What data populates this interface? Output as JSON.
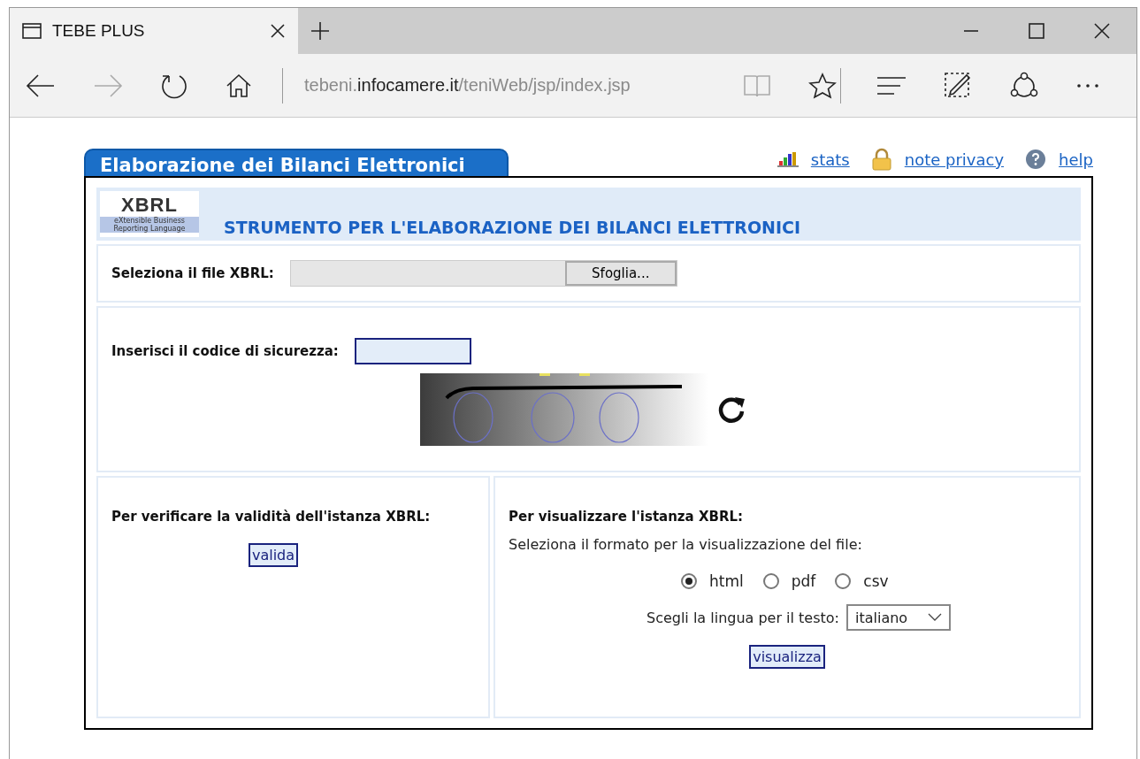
{
  "browser": {
    "tab_title": "TEBE PLUS",
    "url": [
      {
        "kind": "sub",
        "text": "tebeni."
      },
      {
        "kind": "domain",
        "text": "infocamere.it"
      },
      {
        "kind": "path",
        "text": "/teniWeb/jsp/index.jsp"
      }
    ]
  },
  "header": {
    "title": "Elaborazione dei Bilanci Elettronici",
    "links": [
      {
        "kind": "stats",
        "label": "stats"
      },
      {
        "kind": "privacy",
        "label": "note privacy"
      },
      {
        "kind": "help",
        "label": "help"
      }
    ]
  },
  "banner": {
    "logo": "XBRL",
    "logo_tagline": "eXtensible Business Reporting Language",
    "title": "STRUMENTO PER L'ELABORAZIONE DEI BILANCI ELETTRONICI"
  },
  "file_select": {
    "label": "Seleziona il file XBRL:",
    "button": "Sfoglia..."
  },
  "captcha": {
    "label": "Inserisci il codice di sicurezza:"
  },
  "validate": {
    "heading": "Per verificare la validità dell'istanza XBRL:",
    "button": "valida"
  },
  "view": {
    "heading": "Per visualizzare l'istanza XBRL:",
    "format_label": "Seleziona il formato per la visualizzazione del file:",
    "formats": [
      {
        "label": "html",
        "selected": true
      },
      {
        "label": "pdf",
        "selected": false
      },
      {
        "label": "csv",
        "selected": false
      }
    ],
    "language_label": "Scegli la lingua per il testo:",
    "language": "italiano",
    "button": "visualizza"
  }
}
